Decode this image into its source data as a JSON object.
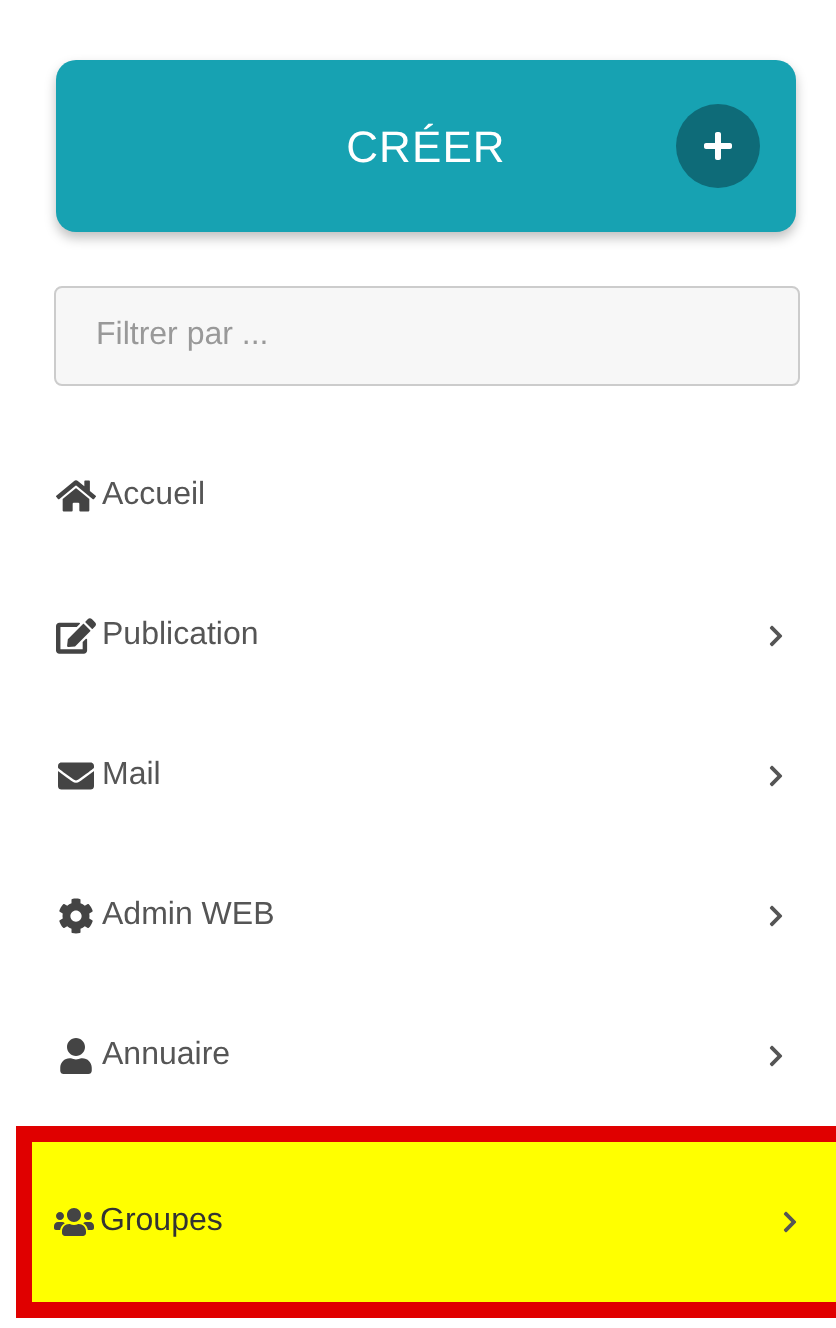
{
  "create_button": {
    "label": "CRÉER"
  },
  "filter": {
    "placeholder": "Filtrer par ..."
  },
  "menu": [
    {
      "label": "Accueil",
      "has_submenu": false,
      "highlighted": false
    },
    {
      "label": "Publication",
      "has_submenu": true,
      "highlighted": false
    },
    {
      "label": "Mail",
      "has_submenu": true,
      "highlighted": false
    },
    {
      "label": "Admin WEB",
      "has_submenu": true,
      "highlighted": false
    },
    {
      "label": "Annuaire",
      "has_submenu": true,
      "highlighted": false
    },
    {
      "label": "Groupes",
      "has_submenu": true,
      "highlighted": true
    }
  ]
}
